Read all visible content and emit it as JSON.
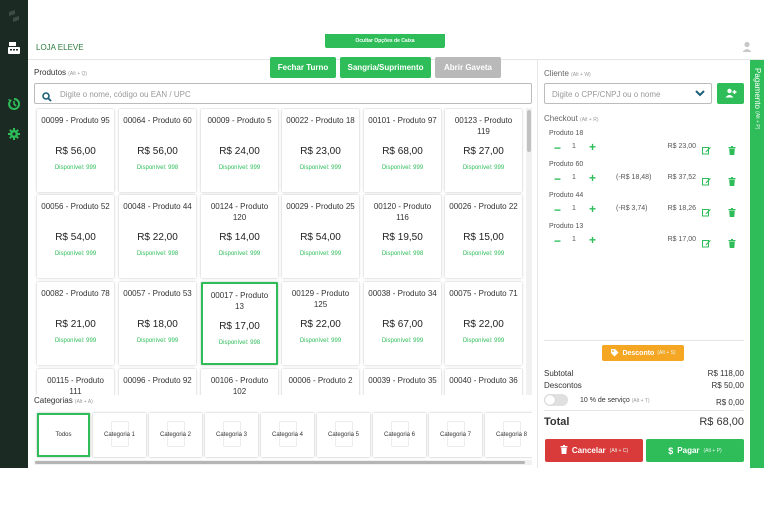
{
  "app": {
    "store_name": "LOJA ELEVE",
    "hide_cash_options": "Ocultar Opções de Caixa"
  },
  "cash_actions": [
    {
      "label": "Fechar Turno",
      "color": "#2ebd59"
    },
    {
      "label": "Sangria/Suprimento",
      "color": "#2ebd59"
    },
    {
      "label": "Abrir Gaveta",
      "color": "#b9b9b9"
    }
  ],
  "produtos": {
    "label": "Produtos",
    "hint": "(Alt + Q)",
    "search_placeholder": "Digite o nome, código ou EAN / UPC"
  },
  "products": [
    {
      "name": "00099 - Produto 95",
      "price": "R$ 56,00",
      "stock": "Disponível: 999"
    },
    {
      "name": "00064 - Produto 60",
      "price": "R$ 56,00",
      "stock": "Disponível: 998"
    },
    {
      "name": "00009 - Produto 5",
      "price": "R$ 24,00",
      "stock": "Disponível: 999"
    },
    {
      "name": "00022 - Produto 18",
      "price": "R$ 23,00",
      "stock": "Disponível: 999"
    },
    {
      "name": "00101 - Produto 97",
      "price": "R$ 68,00",
      "stock": "Disponível: 999"
    },
    {
      "name": "00123 - Produto 119",
      "price": "R$ 27,00",
      "stock": "Disponível: 999"
    },
    {
      "name": "00056 - Produto 52",
      "price": "R$ 54,00",
      "stock": "Disponível: 999"
    },
    {
      "name": "00048 - Produto 44",
      "price": "R$ 22,00",
      "stock": "Disponível: 998"
    },
    {
      "name": "00124 - Produto 120",
      "price": "R$ 14,00",
      "stock": "Disponível: 999"
    },
    {
      "name": "00029 - Produto 25",
      "price": "R$ 54,00",
      "stock": "Disponível: 999"
    },
    {
      "name": "00120 - Produto 116",
      "price": "R$ 19,50",
      "stock": "Disponível: 998"
    },
    {
      "name": "00026 - Produto 22",
      "price": "R$ 15,00",
      "stock": "Disponível: 999"
    },
    {
      "name": "00082 - Produto 78",
      "price": "R$ 21,00",
      "stock": "Disponível: 999"
    },
    {
      "name": "00057 - Produto 53",
      "price": "R$ 18,00",
      "stock": "Disponível: 999"
    },
    {
      "name": "00017 - Produto 13",
      "price": "R$ 17,00",
      "stock": "Disponível: 998",
      "selected": true
    },
    {
      "name": "00129 - Produto 125",
      "price": "R$ 22,00",
      "stock": "Disponível: 999"
    },
    {
      "name": "00038 - Produto 34",
      "price": "R$ 67,00",
      "stock": "Disponível: 999"
    },
    {
      "name": "00075 - Produto 71",
      "price": "R$ 22,00",
      "stock": "Disponível: 999"
    },
    {
      "name": "00115 - Produto 111",
      "price": "",
      "stock": ""
    },
    {
      "name": "00096 - Produto 92",
      "price": "",
      "stock": ""
    },
    {
      "name": "00106 - Produto 102",
      "price": "",
      "stock": ""
    },
    {
      "name": "00006 - Produto 2",
      "price": "",
      "stock": ""
    },
    {
      "name": "00039 - Produto 35",
      "price": "",
      "stock": ""
    },
    {
      "name": "00040 - Produto 36",
      "price": "",
      "stock": ""
    }
  ],
  "categorias": {
    "label": "Categorias",
    "hint": "(Alt + A)"
  },
  "categories": [
    "Todos",
    "Categoria 1",
    "Categoria 2",
    "Categoria 3",
    "Categoria 4",
    "Categoria 5",
    "Categoria 6",
    "Categoria 7",
    "Categoria 8"
  ],
  "cliente": {
    "label": "Cliente",
    "hint": "(Alt + W)",
    "placeholder": "Digite o CPF/CNPJ ou o nome"
  },
  "checkout": {
    "label": "Checkout",
    "hint": "(Alt + R)"
  },
  "cart": [
    {
      "name": "Produto 18",
      "qty": "1",
      "discount": "",
      "total": "R$ 23,00"
    },
    {
      "name": "Produto 60",
      "qty": "1",
      "discount": "(-R$ 18,48)",
      "total": "R$ 37,52"
    },
    {
      "name": "Produto 44",
      "qty": "1",
      "discount": "(-R$ 3,74)",
      "total": "R$ 18,26"
    },
    {
      "name": "Produto 13",
      "qty": "1",
      "discount": "",
      "total": "R$ 17,00"
    }
  ],
  "discount_button": {
    "label": "Desconto",
    "hint": "(Alt + S)"
  },
  "summary": {
    "subtotal_label": "Subtotal",
    "subtotal": "R$ 118,00",
    "descontos_label": "Descontos",
    "descontos": "R$ 50,00",
    "servico_label": "10 % de serviço",
    "servico_hint": "(Alt + T)",
    "servico": "R$ 0,00",
    "total_label": "Total",
    "total": "R$ 68,00"
  },
  "buttons": {
    "cancel_label": "Cancelar",
    "cancel_hint": "(Alt + C)",
    "pay_label": "Pagar",
    "pay_hint": "(Alt + P)"
  },
  "payment_tab": {
    "label": "Pagamento",
    "hint": "(Alt + P)"
  },
  "colors": {
    "accent": "#2ebd59",
    "danger": "#d93a3a",
    "warning": "#f5a623",
    "nav": "#1c2a24"
  }
}
